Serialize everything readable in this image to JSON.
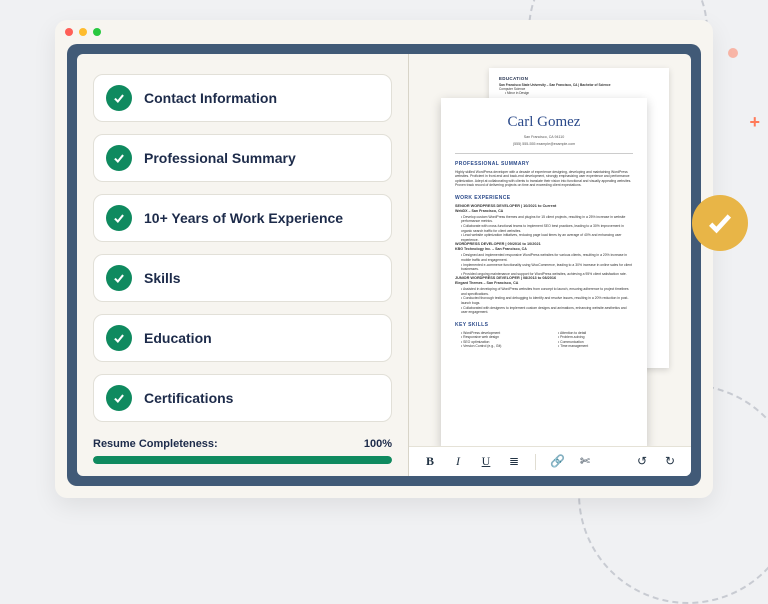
{
  "sections": [
    {
      "label": "Contact Information"
    },
    {
      "label": "Professional Summary"
    },
    {
      "label": "10+ Years of Work Experience"
    },
    {
      "label": "Skills"
    },
    {
      "label": "Education"
    },
    {
      "label": "Certifications"
    }
  ],
  "completeness": {
    "label": "Resume Completeness:",
    "value": "100%",
    "percent": 100
  },
  "toolbar": {
    "bold": "B",
    "italic": "I",
    "underline": "U",
    "list": "≣",
    "link": "🔗",
    "cut": "✄",
    "undo": "↺",
    "redo": "↻"
  },
  "resume": {
    "name": "Carl Gomez",
    "location": "San Francisco, CA 94110",
    "contact": "(555) 555-555 example@example.com",
    "summary_head": "PROFESSIONAL SUMMARY",
    "summary": "Highly skilled WordPress developer with a decade of experience designing, developing and maintaining WordPress websites. Proficient in front-end and back-end development, strongly emphasizing user experience and performance optimization. Adept at collaborating with clients to translate their vision into functional and visually appealing websites. Proven track record of delivering projects on time and exceeding client expectations.",
    "work_head": "WORK EXPERIENCE",
    "jobs": [
      {
        "title": "SENIOR WORDPRESS DEVELOPER",
        "dates": "10/2021 to Current",
        "company": "WebDX – San Francisco, CA",
        "bullets": [
          "Develop custom WordPress themes and plugins for 15 client projects, resulting in a 25% increase in website performance metrics.",
          "Collaborate with cross-functional teams to implement SEO best practices, leading to a 30% improvement in organic search traffic for client websites.",
          "Lead website optimization initiatives, reducing page load times by an average of 40% and enhancing user experience."
        ]
      },
      {
        "title": "WORDPRESS DEVELOPER",
        "dates": "09/2016 to 10/2021",
        "company": "KBG Technology Inc. – San Francisco, CA",
        "bullets": [
          "Designed and implemented responsive WordPress websites for various clients, resulting in a 20% increase in mobile traffic and engagement.",
          "Implemented e-commerce functionality using WooCommerce, leading to a 30% increase in online sales for client businesses.",
          "Provided ongoing maintenance and support for WordPress websites, achieving a 95% client satisfaction rate."
        ]
      },
      {
        "title": "JUNIOR WORDPRESS DEVELOPER",
        "dates": "08/2013 to 08/2016",
        "company": "Elegant Themes – San Francisco, CA",
        "bullets": [
          "Assisted in developing of WordPress websites from concept to launch, ensuring adherence to project timelines and specifications.",
          "Conducted thorough testing and debugging to identify and resolve issues, resulting in a 20% reduction in post-launch bugs.",
          "Collaborated with designers to implement custom designs and animations, enhancing website aesthetics and user engagement."
        ]
      }
    ],
    "skills_head": "KEY SKILLS",
    "skills_left": [
      "WordPress development",
      "Responsive web design",
      "SEO optimization",
      "Version Control (e.g., Git)"
    ],
    "skills_right": [
      "Attention to detail",
      "Problem-solving",
      "Communication",
      "Time management"
    ]
  },
  "back_page": {
    "edu_head": "EDUCATION",
    "school": "San Francisco State University – San Francisco, CA | Bachelor of Science",
    "major": "Computer Science",
    "minor": "Minor in Design"
  }
}
